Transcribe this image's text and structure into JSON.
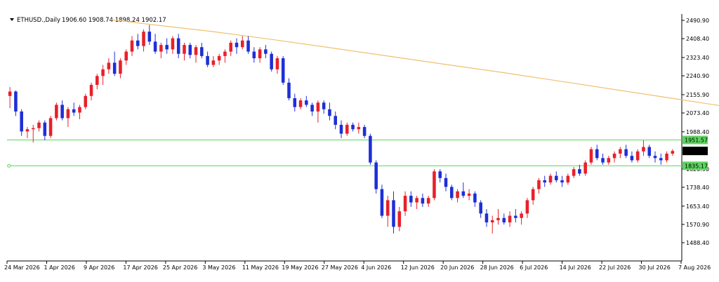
{
  "chart_data": {
    "type": "candlestick",
    "symbol_header": {
      "symbol": "ETHUSD.,Daily",
      "ohlc": "1906.60 1908.74 1898.24 1902.17"
    },
    "y_ticks": [
      "2490.90",
      "2408.40",
      "2323.40",
      "2240.90",
      "2155.90",
      "2073.40",
      "1988.40",
      "1820.90",
      "1738.40",
      "1653.40",
      "1570.90",
      "1488.40"
    ],
    "ylim": [
      1488.4,
      2490.9
    ],
    "x_ticks": [
      "24 Mar 2026",
      "1 Apr 2026",
      "9 Apr 2026",
      "17 Apr 2026",
      "25 Apr 2026",
      "3 May 2026",
      "11 May 2026",
      "19 May 2026",
      "27 May 2026",
      "4 Jun 2026",
      "12 Jun 2026",
      "20 Jun 2026",
      "28 Jun 2026",
      "6 Jul 2026",
      "14 Jul 2026",
      "22 Jul 2026",
      "30 Jul 2026",
      "7 Aug 2026"
    ],
    "levels": [
      {
        "value": 1951.57,
        "label": "1951.57",
        "color": "#5fd35f"
      },
      {
        "value": 1835.17,
        "label": "1835.17",
        "color": "#5fd35f"
      }
    ],
    "current_price": {
      "value": 1902.17,
      "label": "1902.17"
    },
    "moving_average": {
      "color": "#f0c070",
      "points": [
        [
          17,
          2495
        ],
        [
          25,
          2470
        ],
        [
          35,
          2440
        ],
        [
          45,
          2405
        ],
        [
          55,
          2368
        ],
        [
          65,
          2330
        ],
        [
          75,
          2292
        ],
        [
          85,
          2255
        ],
        [
          95,
          2215
        ],
        [
          105,
          2175
        ],
        [
          115,
          2135
        ],
        [
          125,
          2095
        ],
        [
          133,
          2065
        ]
      ]
    },
    "candles": [
      [
        2150,
        2190,
        2095,
        2170
      ],
      [
        2170,
        2175,
        2060,
        2080
      ],
      [
        2080,
        2090,
        1970,
        1990
      ],
      [
        1990,
        2010,
        1960,
        2000
      ],
      [
        2000,
        2020,
        1940,
        2005
      ],
      [
        2005,
        2040,
        1990,
        2030
      ],
      [
        2030,
        2040,
        1950,
        1970
      ],
      [
        1970,
        2060,
        1960,
        2050
      ],
      [
        2050,
        2120,
        2040,
        2110
      ],
      [
        2110,
        2130,
        2040,
        2050
      ],
      [
        2050,
        2100,
        2010,
        2090
      ],
      [
        2090,
        2120,
        2060,
        2075
      ],
      [
        2075,
        2110,
        2045,
        2100
      ],
      [
        2100,
        2160,
        2090,
        2150
      ],
      [
        2150,
        2210,
        2130,
        2200
      ],
      [
        2200,
        2250,
        2180,
        2240
      ],
      [
        2240,
        2290,
        2200,
        2270
      ],
      [
        2270,
        2320,
        2250,
        2300
      ],
      [
        2300,
        2350,
        2240,
        2250
      ],
      [
        2250,
        2320,
        2230,
        2310
      ],
      [
        2310,
        2360,
        2290,
        2350
      ],
      [
        2350,
        2420,
        2330,
        2400
      ],
      [
        2400,
        2430,
        2360,
        2375
      ],
      [
        2375,
        2450,
        2350,
        2440
      ],
      [
        2440,
        2470,
        2380,
        2395
      ],
      [
        2395,
        2430,
        2340,
        2350
      ],
      [
        2350,
        2390,
        2320,
        2380
      ],
      [
        2380,
        2410,
        2340,
        2360
      ],
      [
        2360,
        2420,
        2340,
        2410
      ],
      [
        2410,
        2430,
        2320,
        2340
      ],
      [
        2340,
        2390,
        2310,
        2380
      ],
      [
        2380,
        2390,
        2320,
        2335
      ],
      [
        2335,
        2380,
        2300,
        2370
      ],
      [
        2370,
        2390,
        2320,
        2330
      ],
      [
        2330,
        2350,
        2280,
        2290
      ],
      [
        2290,
        2330,
        2280,
        2310
      ],
      [
        2310,
        2340,
        2290,
        2330
      ],
      [
        2330,
        2360,
        2300,
        2350
      ],
      [
        2350,
        2400,
        2330,
        2390
      ],
      [
        2390,
        2410,
        2340,
        2370
      ],
      [
        2370,
        2420,
        2360,
        2400
      ],
      [
        2400,
        2420,
        2340,
        2350
      ],
      [
        2350,
        2370,
        2300,
        2320
      ],
      [
        2320,
        2370,
        2300,
        2360
      ],
      [
        2360,
        2380,
        2320,
        2340
      ],
      [
        2340,
        2350,
        2260,
        2270
      ],
      [
        2270,
        2330,
        2250,
        2320
      ],
      [
        2320,
        2330,
        2200,
        2210
      ],
      [
        2210,
        2230,
        2130,
        2140
      ],
      [
        2140,
        2160,
        2080,
        2100
      ],
      [
        2100,
        2140,
        2090,
        2130
      ],
      [
        2130,
        2150,
        2100,
        2110
      ],
      [
        2110,
        2120,
        2060,
        2080
      ],
      [
        2080,
        2130,
        2030,
        2120
      ],
      [
        2120,
        2130,
        2070,
        2090
      ],
      [
        2090,
        2120,
        2040,
        2060
      ],
      [
        2060,
        2080,
        2000,
        2020
      ],
      [
        2020,
        2040,
        1960,
        1980
      ],
      [
        1980,
        2030,
        1970,
        2020
      ],
      [
        2020,
        2030,
        1990,
        2000
      ],
      [
        2000,
        2030,
        1980,
        2010
      ],
      [
        2010,
        2020,
        1960,
        1970
      ],
      [
        1970,
        1980,
        1840,
        1850
      ],
      [
        1850,
        1860,
        1710,
        1730
      ],
      [
        1730,
        1750,
        1600,
        1610
      ],
      [
        1610,
        1700,
        1560,
        1680
      ],
      [
        1680,
        1720,
        1530,
        1560
      ],
      [
        1560,
        1650,
        1540,
        1630
      ],
      [
        1630,
        1720,
        1610,
        1700
      ],
      [
        1700,
        1720,
        1650,
        1670
      ],
      [
        1670,
        1700,
        1640,
        1690
      ],
      [
        1690,
        1710,
        1650,
        1665
      ],
      [
        1665,
        1700,
        1650,
        1690
      ],
      [
        1690,
        1820,
        1680,
        1810
      ],
      [
        1810,
        1820,
        1760,
        1780
      ],
      [
        1780,
        1800,
        1720,
        1740
      ],
      [
        1740,
        1750,
        1680,
        1690
      ],
      [
        1690,
        1730,
        1670,
        1720
      ],
      [
        1720,
        1760,
        1690,
        1700
      ],
      [
        1700,
        1730,
        1680,
        1710
      ],
      [
        1710,
        1720,
        1650,
        1670
      ],
      [
        1670,
        1680,
        1600,
        1620
      ],
      [
        1620,
        1640,
        1560,
        1580
      ],
      [
        1580,
        1610,
        1530,
        1590
      ],
      [
        1590,
        1640,
        1570,
        1600
      ],
      [
        1600,
        1620,
        1570,
        1580
      ],
      [
        1580,
        1630,
        1560,
        1610
      ],
      [
        1610,
        1640,
        1580,
        1600
      ],
      [
        1600,
        1630,
        1570,
        1620
      ],
      [
        1620,
        1690,
        1600,
        1680
      ],
      [
        1680,
        1740,
        1660,
        1730
      ],
      [
        1730,
        1780,
        1710,
        1770
      ],
      [
        1770,
        1790,
        1740,
        1760
      ],
      [
        1760,
        1800,
        1750,
        1790
      ],
      [
        1790,
        1810,
        1760,
        1770
      ],
      [
        1770,
        1790,
        1740,
        1760
      ],
      [
        1760,
        1800,
        1750,
        1790
      ],
      [
        1790,
        1830,
        1780,
        1820
      ],
      [
        1820,
        1840,
        1790,
        1800
      ],
      [
        1800,
        1860,
        1790,
        1850
      ],
      [
        1850,
        1920,
        1840,
        1910
      ],
      [
        1910,
        1930,
        1860,
        1870
      ],
      [
        1870,
        1890,
        1840,
        1850
      ],
      [
        1850,
        1880,
        1840,
        1870
      ],
      [
        1870,
        1900,
        1850,
        1890
      ],
      [
        1890,
        1920,
        1870,
        1910
      ],
      [
        1910,
        1930,
        1870,
        1880
      ],
      [
        1880,
        1900,
        1850,
        1860
      ],
      [
        1860,
        1910,
        1850,
        1900
      ],
      [
        1900,
        1950,
        1880,
        1920
      ],
      [
        1920,
        1930,
        1870,
        1880
      ],
      [
        1880,
        1900,
        1850,
        1870
      ],
      [
        1870,
        1890,
        1840,
        1860
      ],
      [
        1860,
        1900,
        1850,
        1890
      ],
      [
        1890,
        1910,
        1880,
        1902
      ]
    ]
  }
}
